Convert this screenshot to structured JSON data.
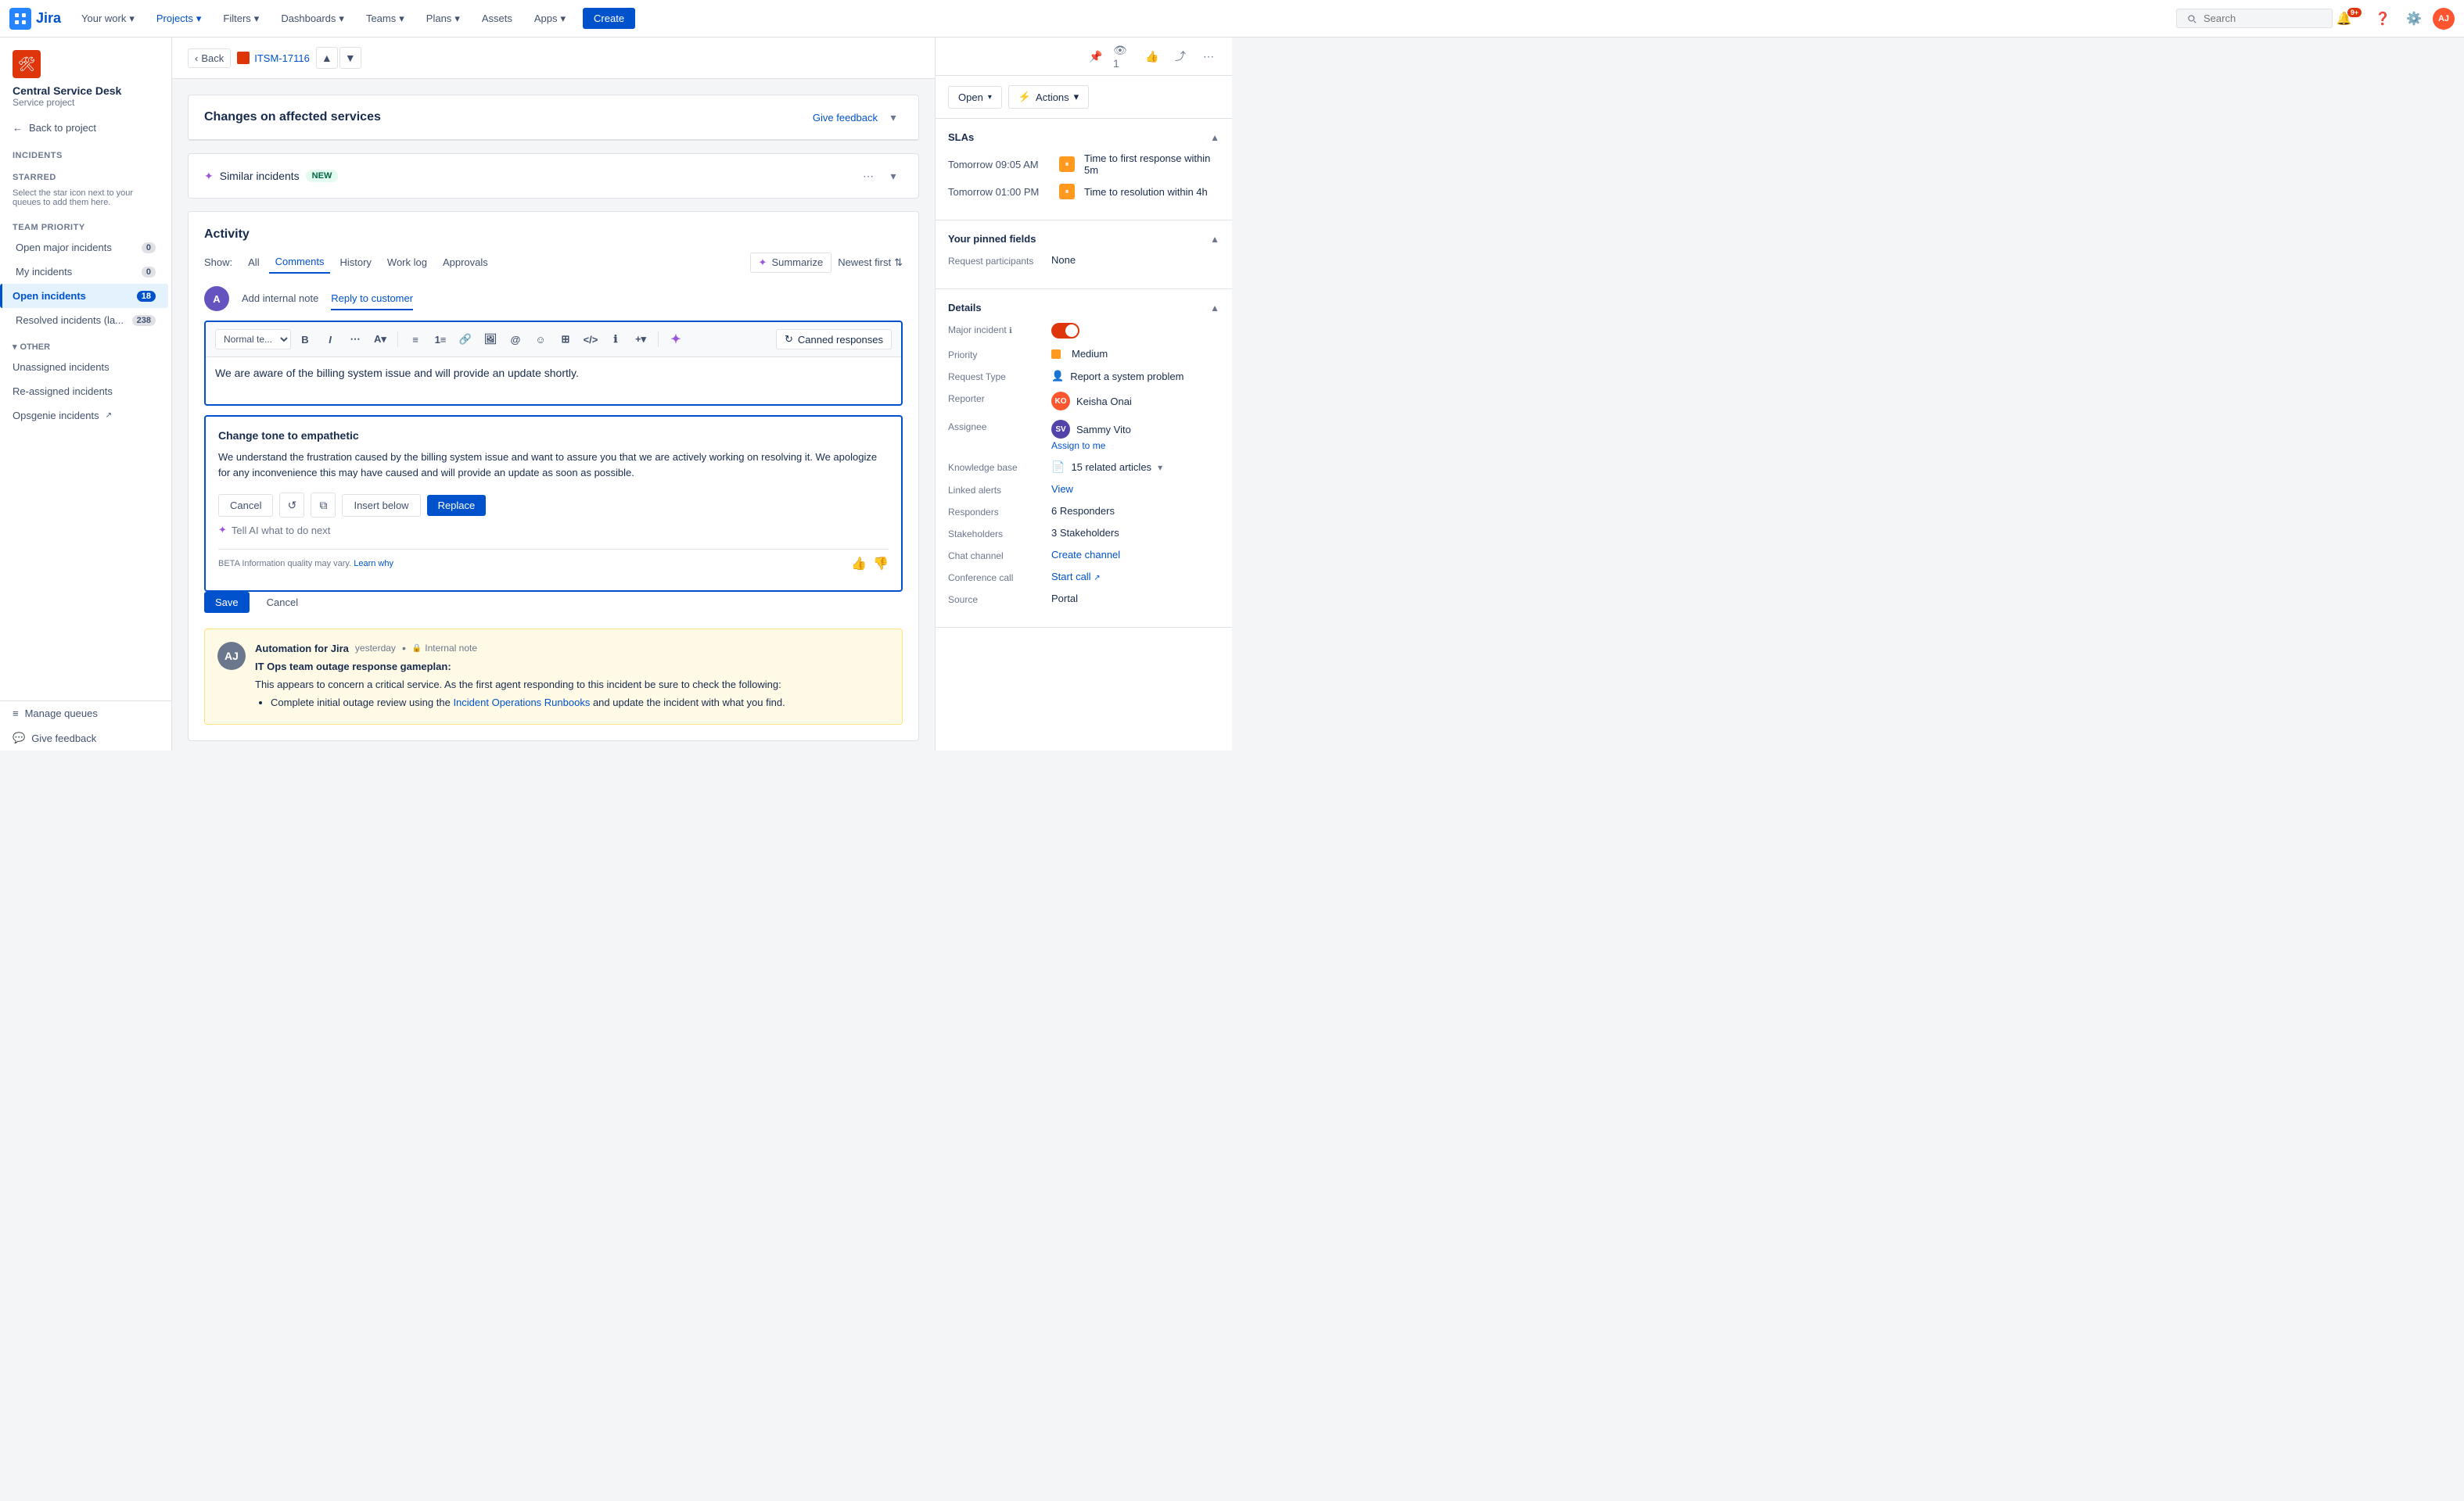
{
  "nav": {
    "logo_text": "Jira",
    "items": [
      "Your work",
      "Projects",
      "Filters",
      "Dashboards",
      "Teams",
      "Plans",
      "Assets",
      "Apps"
    ],
    "create_label": "Create",
    "search_placeholder": "Search",
    "notification_count": "9+"
  },
  "sidebar": {
    "project_name": "Central Service Desk",
    "project_type": "Service project",
    "back_label": "Back to project",
    "nav_title": "Incidents",
    "starred_title": "STARRED",
    "starred_hint": "Select the star icon next to your queues to add them here.",
    "team_priority_title": "TEAM PRIORITY",
    "team_items": [
      {
        "label": "Open major incidents",
        "count": "0"
      },
      {
        "label": "My incidents",
        "count": "0"
      },
      {
        "label": "Open incidents",
        "count": "18",
        "active": true
      },
      {
        "label": "Resolved incidents (la...",
        "count": "238"
      }
    ],
    "other_title": "OTHER",
    "other_items": [
      {
        "label": "Unassigned incidents"
      },
      {
        "label": "Re-assigned incidents"
      },
      {
        "label": "Opsgenie incidents"
      }
    ],
    "manage_queues": "Manage queues",
    "give_feedback": "Give feedback"
  },
  "breadcrumb": {
    "back_label": "Back",
    "issue_key": "ITSM-17116"
  },
  "issue": {
    "title": "Changes on affected services",
    "give_feedback": "Give feedback"
  },
  "similar": {
    "label": "Similar incidents",
    "badge": "NEW"
  },
  "activity": {
    "title": "Activity",
    "show_label": "Show:",
    "tabs": [
      "All",
      "Comments",
      "History",
      "Work log",
      "Approvals"
    ],
    "active_tab": "Comments",
    "summarize_label": "Summarize",
    "newest_first_label": "Newest first",
    "reply_tabs": [
      "Add internal note",
      "Reply to customer"
    ],
    "active_reply_tab": "Reply to customer",
    "editor_text": "We are aware of the billing system issue and will provide an update shortly.",
    "toolbar": {
      "text_style": "Normal te...",
      "canned_responses": "Canned responses"
    }
  },
  "ai": {
    "suggestion_title": "Change tone to empathetic",
    "suggestion_text": "We understand the frustration caused by the billing system issue and want to assure you that we are actively working on resolving it. We apologize for any inconvenience this may have caused and will provide an update as soon as possible.",
    "cancel_label": "Cancel",
    "insert_below_label": "Insert below",
    "replace_label": "Replace",
    "tell_label": "Tell AI what to do next",
    "beta_text": "BETA  Information quality may vary.",
    "learn_why": "Learn why"
  },
  "editor_footer": {
    "save_label": "Save",
    "cancel_label": "Cancel"
  },
  "automation_entry": {
    "author": "Automation for Jira",
    "time": "yesterday",
    "badge": "Internal note",
    "title": "IT Ops team outage response gameplan:",
    "intro": "This appears to concern a critical service. As the first agent responding to this incident be sure to check the following:",
    "list_item": "Complete initial outage review using the",
    "link_text": "Incident Operations Runbooks",
    "list_item_end": "and update the incident with what you find."
  },
  "right_panel": {
    "open_label": "Open",
    "actions_label": "Actions",
    "sla_title": "SLAs",
    "sla_items": [
      {
        "time": "Tomorrow 09:05 AM",
        "label": "Time to first response within 5m"
      },
      {
        "time": "Tomorrow 01:00 PM",
        "label": "Time to resolution within 4h"
      }
    ],
    "pinned_title": "Your pinned fields",
    "request_participants_label": "Request participants",
    "request_participants_value": "None",
    "details_title": "Details",
    "major_incident_label": "Major incident",
    "priority_label": "Priority",
    "priority_value": "Medium",
    "request_type_label": "Request Type",
    "request_type_value": "Report a system problem",
    "reporter_label": "Reporter",
    "reporter_value": "Keisha Onai",
    "assignee_label": "Assignee",
    "assignee_value": "Sammy Vito",
    "assign_to_me": "Assign to me",
    "knowledge_base_label": "Knowledge base",
    "knowledge_base_value": "15 related articles",
    "linked_alerts_label": "Linked alerts",
    "linked_alerts_value": "View",
    "responders_label": "Responders",
    "responders_value": "6 Responders",
    "stakeholders_label": "Stakeholders",
    "stakeholders_value": "3 Stakeholders",
    "chat_channel_label": "Chat channel",
    "chat_channel_value": "Create channel",
    "conference_call_label": "Conference call",
    "conference_call_value": "Start call",
    "source_label": "Source",
    "source_value": "Portal"
  }
}
